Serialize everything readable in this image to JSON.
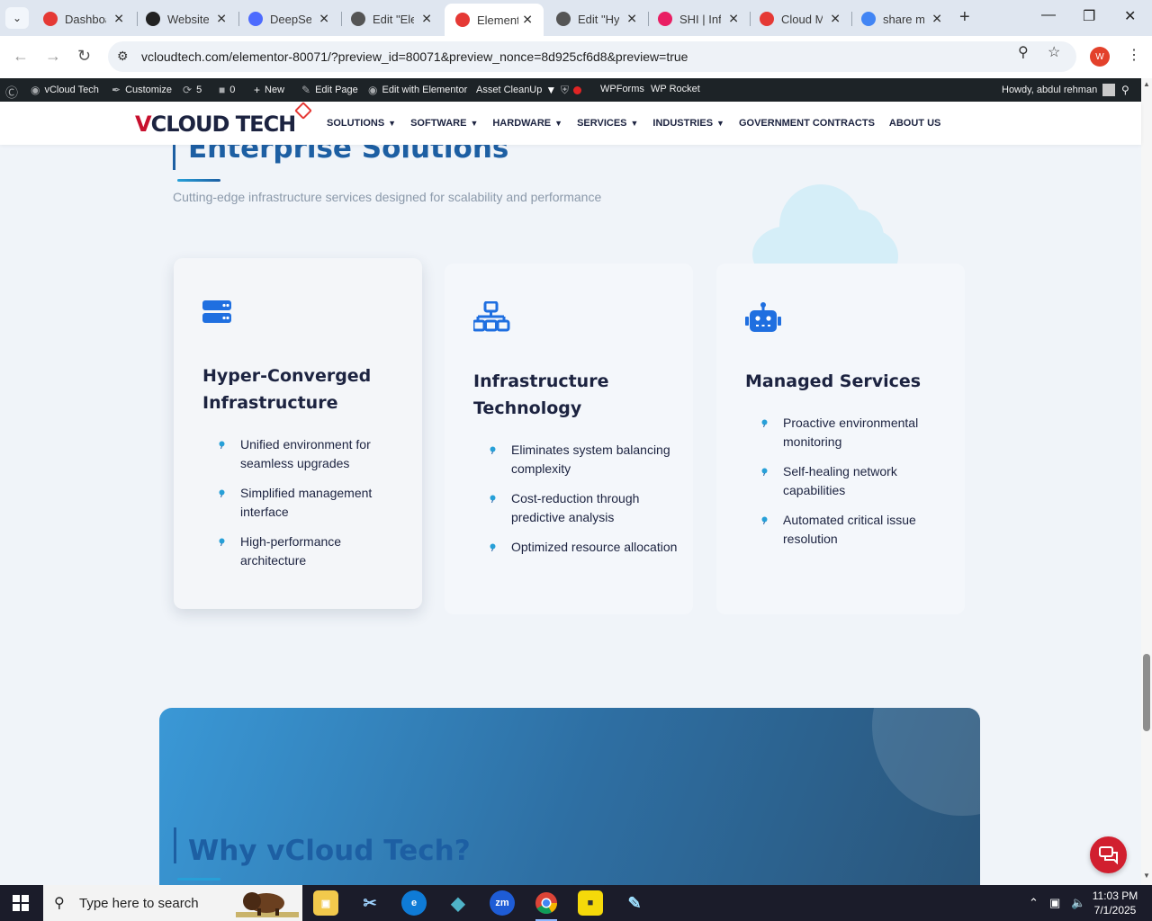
{
  "browser": {
    "tabs": [
      {
        "label": "Dashboard",
        "color": "#e53935"
      },
      {
        "label": "Website",
        "color": "#222222"
      },
      {
        "label": "DeepSeek",
        "color": "#4d6bfe"
      },
      {
        "label": "Edit \"Ele",
        "color": "#555555"
      },
      {
        "label": "Elementor",
        "color": "#e53935"
      },
      {
        "label": "Edit \"Hy",
        "color": "#555555"
      },
      {
        "label": "SHI | Inf",
        "color": "#e91e63"
      },
      {
        "label": "Cloud M",
        "color": "#e53935"
      },
      {
        "label": "share m",
        "color": "#4285f4"
      }
    ],
    "active_tab": 4,
    "url": "vcloudtech.com/elementor-80071/?preview_id=80071&preview_nonce=8d925cf6d8&preview=true",
    "profile_initial": "W"
  },
  "wpbar": {
    "site_name": "vCloud Tech",
    "customize": "Customize",
    "updates": "5",
    "comments": "0",
    "new": "New",
    "edit_page": "Edit Page",
    "edit_elementor": "Edit with Elementor",
    "asset_cleanup": "Asset CleanUp",
    "wpforms": "WPForms",
    "wprocket": "WP Rocket",
    "howdy": "Howdy, abdul rehman"
  },
  "site": {
    "logo_v": "V",
    "logo_rest": "CLOUD TECH",
    "menu": [
      {
        "label": "SOLUTIONS",
        "dropdown": true
      },
      {
        "label": "SOFTWARE",
        "dropdown": true
      },
      {
        "label": "HARDWARE",
        "dropdown": true
      },
      {
        "label": "SERVICES",
        "dropdown": true
      },
      {
        "label": "INDUSTRIES",
        "dropdown": true
      },
      {
        "label": "GOVERNMENT CONTRACTS",
        "dropdown": false
      },
      {
        "label": "ABOUT US",
        "dropdown": false
      }
    ]
  },
  "section": {
    "title": "Enterprise Solutions",
    "subtitle": "Cutting-edge infrastructure services designed for scalability and performance",
    "cards": [
      {
        "icon": "server-icon",
        "title_line1": "Hyper-Converged",
        "title_line2": "Infrastructure",
        "items": [
          "Unified environment for seamless upgrades",
          "Simplified management interface",
          "High-performance architecture"
        ]
      },
      {
        "icon": "network-icon",
        "title_line1": "Infrastructure",
        "title_line2": "Technology",
        "items": [
          "Eliminates system balancing complexity",
          "Cost-reduction through predictive analysis",
          "Optimized resource allocation"
        ]
      },
      {
        "icon": "robot-icon",
        "title_line1": "Managed Services",
        "title_line2": "",
        "items": [
          "Proactive environmental monitoring",
          "Self-healing network capabilities",
          "Automated critical issue resolution"
        ]
      }
    ],
    "why_title": "Why vCloud Tech?"
  },
  "taskbar": {
    "search_placeholder": "Type here to search",
    "time": "11:03 PM",
    "date": "7/1/2025",
    "zoom_label": "zm"
  },
  "colors": {
    "accent": "#1d5fa3",
    "icon_blue": "#1f6fe0",
    "brand_red": "#c8102e"
  }
}
